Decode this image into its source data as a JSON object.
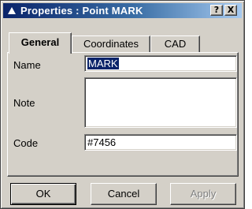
{
  "window": {
    "title": "Properties : Point MARK",
    "icon": "triangle-app-icon",
    "help_label": "?",
    "close_label": "X"
  },
  "tabs": [
    {
      "label": "General",
      "active": true
    },
    {
      "label": "Coordinates",
      "active": false
    },
    {
      "label": "CAD",
      "active": false
    }
  ],
  "form": {
    "name_label": "Name",
    "name_value": "MARK",
    "note_label": "Note",
    "note_value": "",
    "code_label": "Code",
    "code_value": "#7456"
  },
  "buttons": {
    "ok": "OK",
    "cancel": "Cancel",
    "apply": "Apply"
  },
  "colors": {
    "titlebar_start": "#0a246a",
    "titlebar_end": "#a6caf0",
    "selection": "#0a246a",
    "dialog_face": "#d4d0c8"
  }
}
